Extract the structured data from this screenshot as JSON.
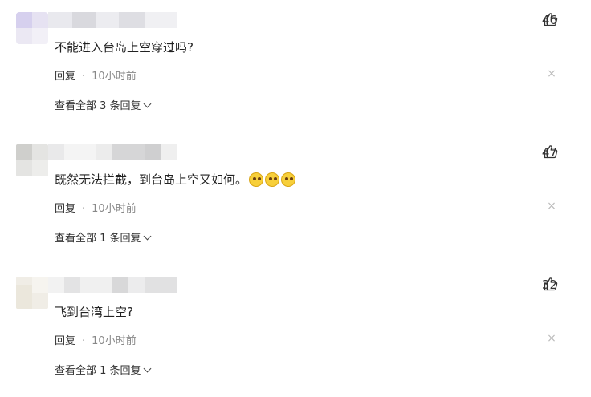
{
  "comments": [
    {
      "text": "不能进入台岛上空穿过吗?",
      "likes": "46",
      "reply_label": "回复",
      "separator": "·",
      "time": "10小时前",
      "close_icon": "×",
      "view_all": "查看全部 3 条回复",
      "emoji_count": 0
    },
    {
      "text": "既然无法拦截，到台岛上空又如何。",
      "likes": "47",
      "reply_label": "回复",
      "separator": "·",
      "time": "10小时前",
      "close_icon": "×",
      "view_all": "查看全部 1 条回复",
      "emoji_count": 3
    },
    {
      "text": "飞到台湾上空?",
      "likes": "32",
      "reply_label": "回复",
      "separator": "·",
      "time": "10小时前",
      "close_icon": "×",
      "view_all": "查看全部 1 条回复",
      "emoji_count": 0
    }
  ],
  "icons": {
    "like": "thumbs-up-icon",
    "close": "close-icon",
    "expand": "chevron-down-icon",
    "emoji": "thinking-face-emoji"
  },
  "colors": {
    "text": "#222222",
    "meta": "#888888",
    "close": "#bbbbbb"
  }
}
